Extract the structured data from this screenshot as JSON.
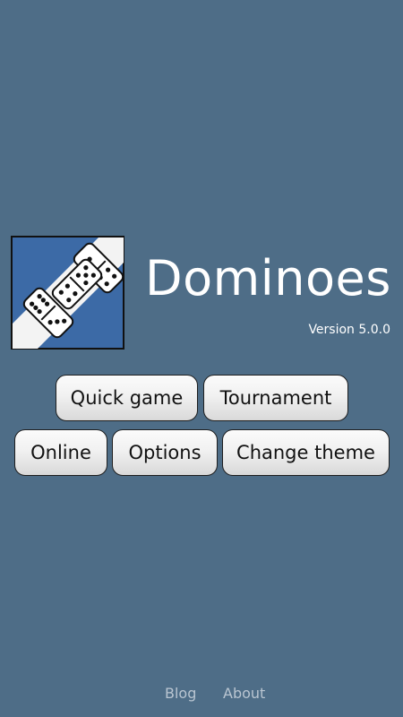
{
  "app": {
    "title": "Dominoes",
    "version": "Version 5.0.0"
  },
  "menu": {
    "quick_game": "Quick game",
    "tournament": "Tournament",
    "online": "Online",
    "options": "Options",
    "change_theme": "Change theme"
  },
  "footer": {
    "blog": "Blog",
    "about": "About"
  },
  "colors": {
    "background": "#4e6d87",
    "logo_blue": "#3c6aa6",
    "button_face": "#f1f1f1",
    "footer_link": "#b9c5d1"
  },
  "icons": {
    "logo": "dominoes-logo-icon"
  }
}
